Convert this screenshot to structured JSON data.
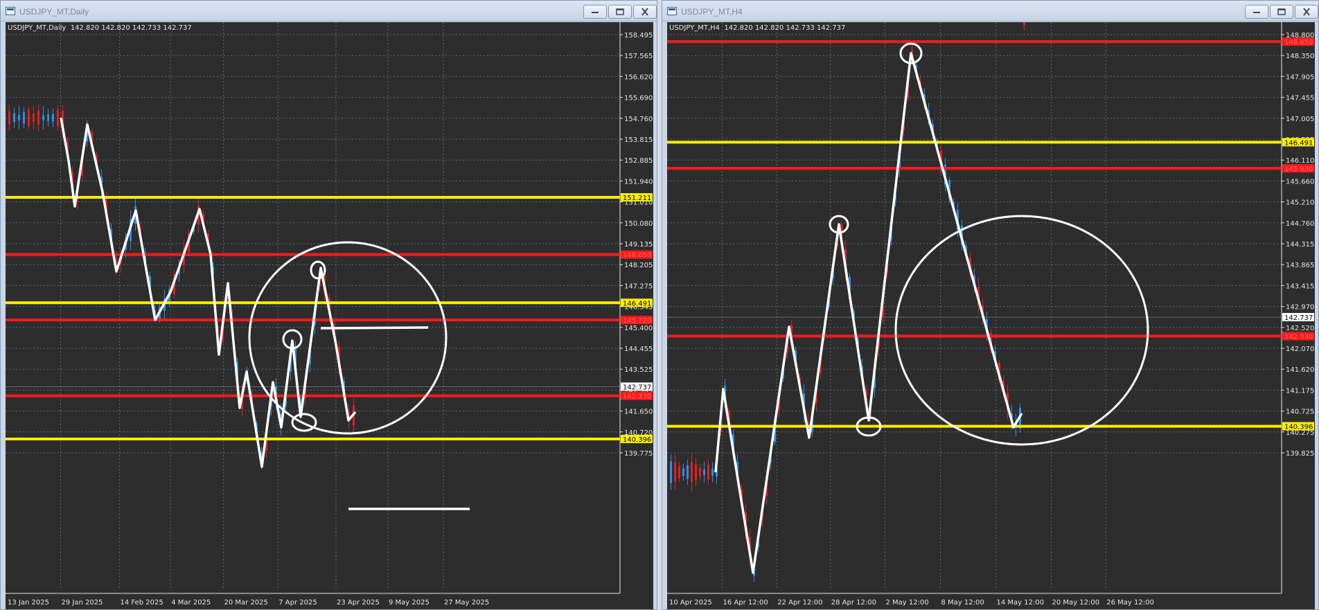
{
  "colors": {
    "chart_bg": "#2d2d2d",
    "grid": "#5f6670",
    "axis_text": "#e6e6e6",
    "bull": "#2f8fe8",
    "bear": "#e02020",
    "red_line": "#ff1a1a",
    "yellow_line": "#ffee00",
    "drawing": "#ffffff"
  },
  "windows": [
    {
      "id": "left",
      "title": "USDJPY_MT,Daily",
      "symbol_label": "USDJPY_MT,Daily",
      "ohlc": "142.820 142.820 142.733 142.737",
      "y_ticks": [
        "158.495",
        "157.565",
        "156.620",
        "155.690",
        "154.760",
        "153.815",
        "152.885",
        "151.940",
        "151.010",
        "150.080",
        "149.135",
        "148.205",
        "147.275",
        "146.345",
        "145.400",
        "144.455",
        "143.525",
        "142.595",
        "141.650",
        "140.720",
        "139.775"
      ],
      "x_ticks": [
        "13 Jan 2025",
        "29 Jan 2025",
        "14 Feb 2025",
        "4 Mar 2025",
        "20 Mar 2025",
        "7 Apr 2025",
        "23 Apr 2025",
        "9 May 2025",
        "27 May 2025"
      ],
      "levels": [
        {
          "price": 151.211,
          "label": "151.211",
          "color": "yellow"
        },
        {
          "price": 148.65,
          "label": "148.650",
          "color": "red"
        },
        {
          "price": 146.491,
          "label": "146.491",
          "color": "yellow"
        },
        {
          "price": 145.72,
          "label": "145.720",
          "color": "red"
        },
        {
          "price": 142.33,
          "label": "142.330",
          "color": "red"
        },
        {
          "price": 140.396,
          "label": "140.396",
          "color": "yellow"
        }
      ],
      "current_price": "142.737"
    },
    {
      "id": "right",
      "title": "USDJPY_MT,H4",
      "symbol_label": "USDJPY_MT,H4",
      "ohlc": "142.820 142.820 142.733 142.737",
      "y_ticks": [
        "148.800",
        "148.350",
        "147.905",
        "147.455",
        "147.005",
        "146.555",
        "146.110",
        "145.660",
        "145.210",
        "144.760",
        "144.315",
        "143.865",
        "143.415",
        "142.970",
        "142.520",
        "142.070",
        "141.620",
        "141.175",
        "140.725",
        "140.275",
        "139.825"
      ],
      "x_ticks": [
        "10 Apr 2025",
        "16 Apr 12:00",
        "22 Apr 12:00",
        "28 Apr 12:00",
        "2 May 12:00",
        "8 May 12:00",
        "14 May 12:00",
        "20 May 12:00",
        "26 May 12:00"
      ],
      "levels": [
        {
          "price": 148.65,
          "label": "148.650",
          "color": "red"
        },
        {
          "price": 146.491,
          "label": "146.491",
          "color": "yellow"
        },
        {
          "price": 145.93,
          "label": "145.930",
          "color": "red"
        },
        {
          "price": 142.33,
          "label": "142.330",
          "color": "red"
        },
        {
          "price": 140.396,
          "label": "140.396",
          "color": "yellow"
        }
      ],
      "current_price": "142.737"
    }
  ]
}
